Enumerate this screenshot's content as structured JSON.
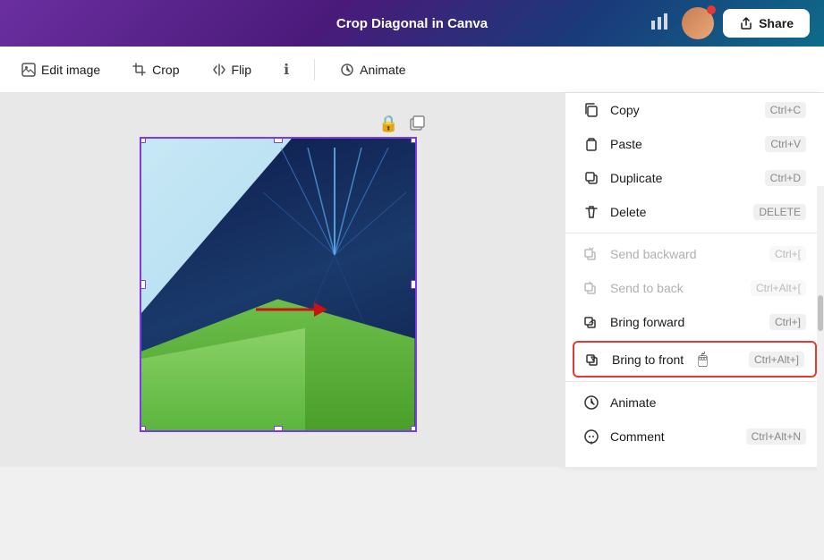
{
  "topbar": {
    "title": "Crop Diagonal in Canva",
    "share_label": "Share"
  },
  "toolbar": {
    "edit_image": "Edit image",
    "crop": "Crop",
    "flip": "Flip",
    "info_icon": "ℹ",
    "animate": "Animate"
  },
  "context_menu": {
    "items": [
      {
        "id": "copy",
        "label": "Copy",
        "shortcut": "Ctrl+C",
        "icon": "copy",
        "disabled": false,
        "highlighted": false
      },
      {
        "id": "paste",
        "label": "Paste",
        "shortcut": "Ctrl+V",
        "icon": "paste",
        "disabled": false,
        "highlighted": false
      },
      {
        "id": "duplicate",
        "label": "Duplicate",
        "shortcut": "Ctrl+D",
        "icon": "duplicate",
        "disabled": false,
        "highlighted": false
      },
      {
        "id": "delete",
        "label": "Delete",
        "shortcut": "DELETE",
        "icon": "delete",
        "disabled": false,
        "highlighted": false
      },
      {
        "id": "send-backward",
        "label": "Send backward",
        "shortcut": "Ctrl+[",
        "icon": "send-backward",
        "disabled": true,
        "highlighted": false
      },
      {
        "id": "send-to-back",
        "label": "Send to back",
        "shortcut": "Ctrl+Alt+[",
        "icon": "send-to-back",
        "disabled": true,
        "highlighted": false
      },
      {
        "id": "bring-forward",
        "label": "Bring forward",
        "shortcut": "Ctrl+]",
        "icon": "bring-forward",
        "disabled": false,
        "highlighted": false
      },
      {
        "id": "bring-to-front",
        "label": "Bring to front",
        "shortcut": "Ctrl+Alt+]",
        "icon": "bring-to-front",
        "disabled": false,
        "highlighted": true
      },
      {
        "id": "animate",
        "label": "Animate",
        "shortcut": "",
        "icon": "animate",
        "disabled": false,
        "highlighted": false
      },
      {
        "id": "comment",
        "label": "Comment",
        "shortcut": "Ctrl+Alt+N",
        "icon": "comment",
        "disabled": false,
        "highlighted": false
      }
    ]
  }
}
